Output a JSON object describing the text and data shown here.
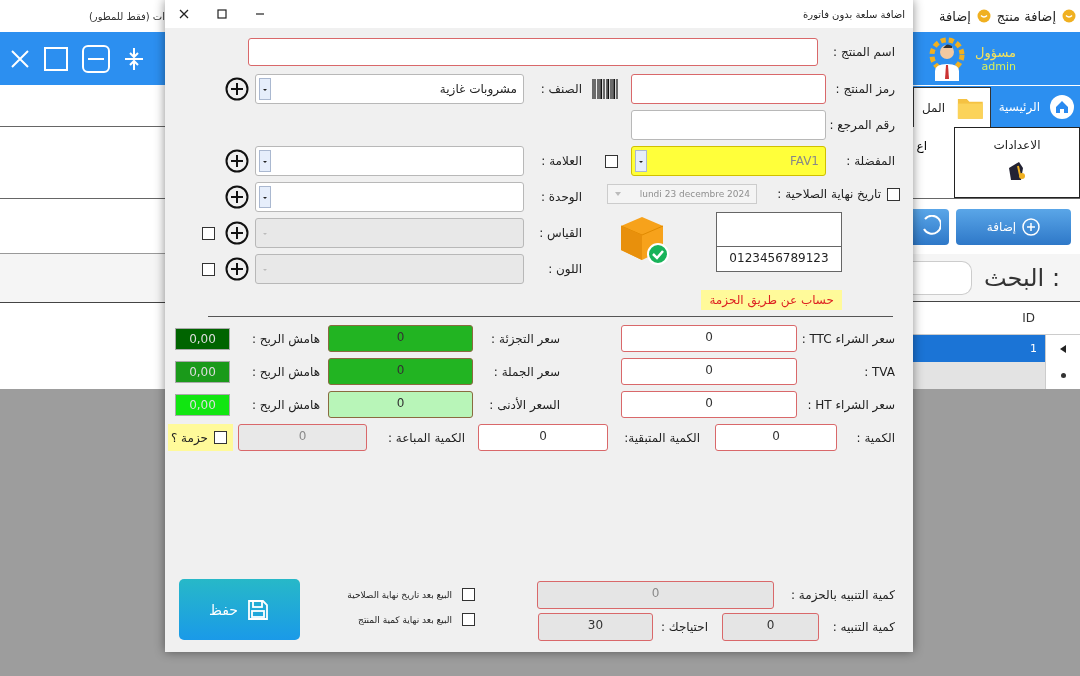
{
  "app": {
    "top_menu": [
      {
        "label": "إضافة منتج"
      },
      {
        "label": "إضافة"
      }
    ],
    "developer_note": "ات (فقط للمطور)",
    "user": {
      "role": "مسؤول",
      "username": "admin"
    },
    "nav_tabs": [
      {
        "label": "الرئيسية",
        "selected": false
      },
      {
        "label": "المل",
        "selected": true
      }
    ],
    "ribbon": [
      {
        "label": "الاعدادات"
      },
      {
        "label": "اع"
      }
    ],
    "add_button": "إضافة",
    "search": {
      "label": "البحث :"
    },
    "table": {
      "columns": [
        "ID"
      ],
      "rows": [
        {
          "id": "1",
          "selected": true
        },
        {
          "selected": false
        }
      ]
    }
  },
  "dialog": {
    "title": "اضافة سلعة بدون فاتورة",
    "product_name": {
      "label": "اسم المنتج :",
      "required": true
    },
    "product_code": {
      "label": "رمز المنتج :",
      "required": true
    },
    "reference": {
      "label": "رقم المرجع :",
      "required": false
    },
    "favorite": {
      "label": "المفضلة :",
      "value": "FAV1",
      "checked": false
    },
    "expiry": {
      "label": "تاريخ نهاية الصلاحية :",
      "checked": false,
      "value": "lundi 23 decembre 2024",
      "disabled": true
    },
    "barcode_preview": "0123456789123",
    "pack_calc": "حساب عن طريق الحزمة",
    "attributes": [
      {
        "label": "الصنف :",
        "value": "مشروبات غازية",
        "disabled": false
      },
      {
        "label": "العلامة :",
        "disabled": false
      },
      {
        "label": "الوحدة :",
        "disabled": false
      },
      {
        "label": "القياس :",
        "disabled": true,
        "checked": false
      },
      {
        "label": "اللون :",
        "disabled": true,
        "checked": false
      }
    ],
    "prices": [
      {
        "label": "سعر الشراء TTC :",
        "value": "0",
        "sale": {
          "label": "سعر التجزئة :",
          "value": "0",
          "color": "#22b422"
        },
        "margin": {
          "label": "هامش الربح :",
          "value": "0,00",
          "color": "#006400"
        }
      },
      {
        "label": "TVA :",
        "value": "0",
        "sale": {
          "label": "سعر الجملة :",
          "value": "0",
          "color": "#22b422"
        },
        "margin": {
          "label": "هامش الربح :",
          "value": "0,00",
          "color": "#1a9a1a"
        }
      },
      {
        "label": "سعر الشراء HT :",
        "value": "0",
        "sale": {
          "label": "السعر الأدنى :",
          "value": "0",
          "color": "#b8f5b8"
        },
        "margin": {
          "label": "هامش الربح :",
          "value": "0,00",
          "color": "#11e611"
        }
      }
    ],
    "quantities": [
      {
        "label": "الكمية :",
        "value": "0",
        "disabled": false
      },
      {
        "label": "الكمية المتبقية:",
        "value": "0",
        "disabled": false
      },
      {
        "label": "الكمية المباعة :",
        "value": "0",
        "disabled": true
      }
    ],
    "pack": {
      "label": "حزمة ؟",
      "checked": false
    },
    "pack_alert": {
      "label": "كمية التنبيه بالحزمة :",
      "value": "0",
      "disabled": true
    },
    "alert": {
      "label": "كمية التنبيه :",
      "value": "0",
      "disabled": false
    },
    "need": {
      "label": "احتياجك :",
      "value": "30",
      "disabled": false
    },
    "sell_options": [
      {
        "label": "البيع بعد تاريخ نهاية الصلاحية",
        "checked": false
      },
      {
        "label": "البيع بعد نهاية كمية المنتج",
        "checked": false
      }
    ],
    "save_button": "حفظ"
  }
}
